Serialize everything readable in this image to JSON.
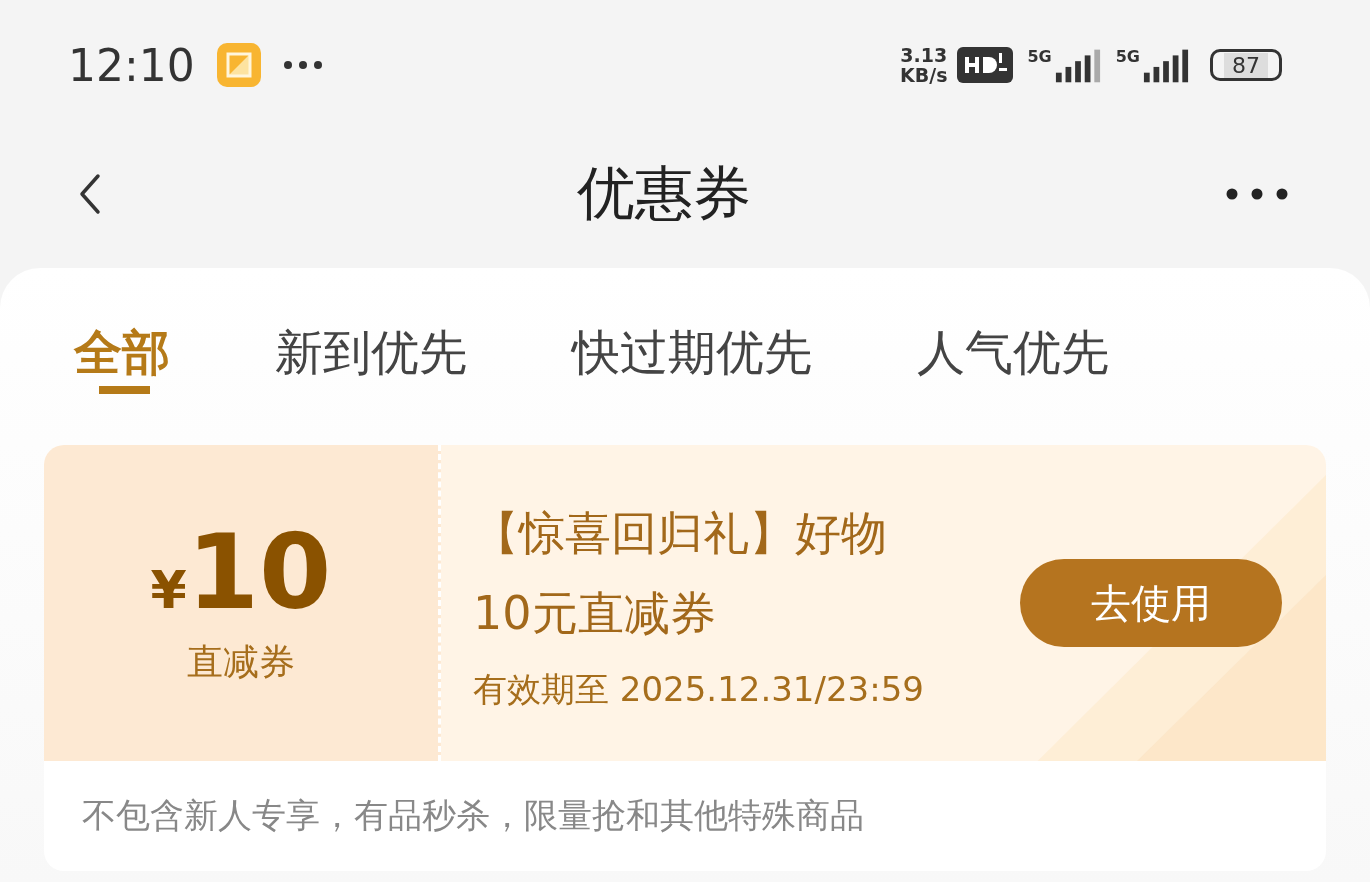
{
  "status_bar": {
    "time": "12:10",
    "speed": [
      "3.13",
      "KB/s"
    ],
    "network": [
      "5G",
      "5G"
    ],
    "battery": "87"
  },
  "header": {
    "title": "优惠券"
  },
  "tabs": [
    {
      "label": "全部",
      "selected": true
    },
    {
      "label": "新到优先",
      "selected": false
    },
    {
      "label": "快过期优先",
      "selected": false
    },
    {
      "label": "人气优先",
      "selected": false
    }
  ],
  "coupons": [
    {
      "currency": "¥",
      "amount": "10",
      "type": "直减券",
      "title": "【惊喜回归礼】好物",
      "subtitle": "10元直减券",
      "validity": "有效期至 2025.12.31/23:59",
      "button": "去使用",
      "note": "不包含新人专享，有品秒杀，限量抢和其他特殊商品"
    }
  ]
}
